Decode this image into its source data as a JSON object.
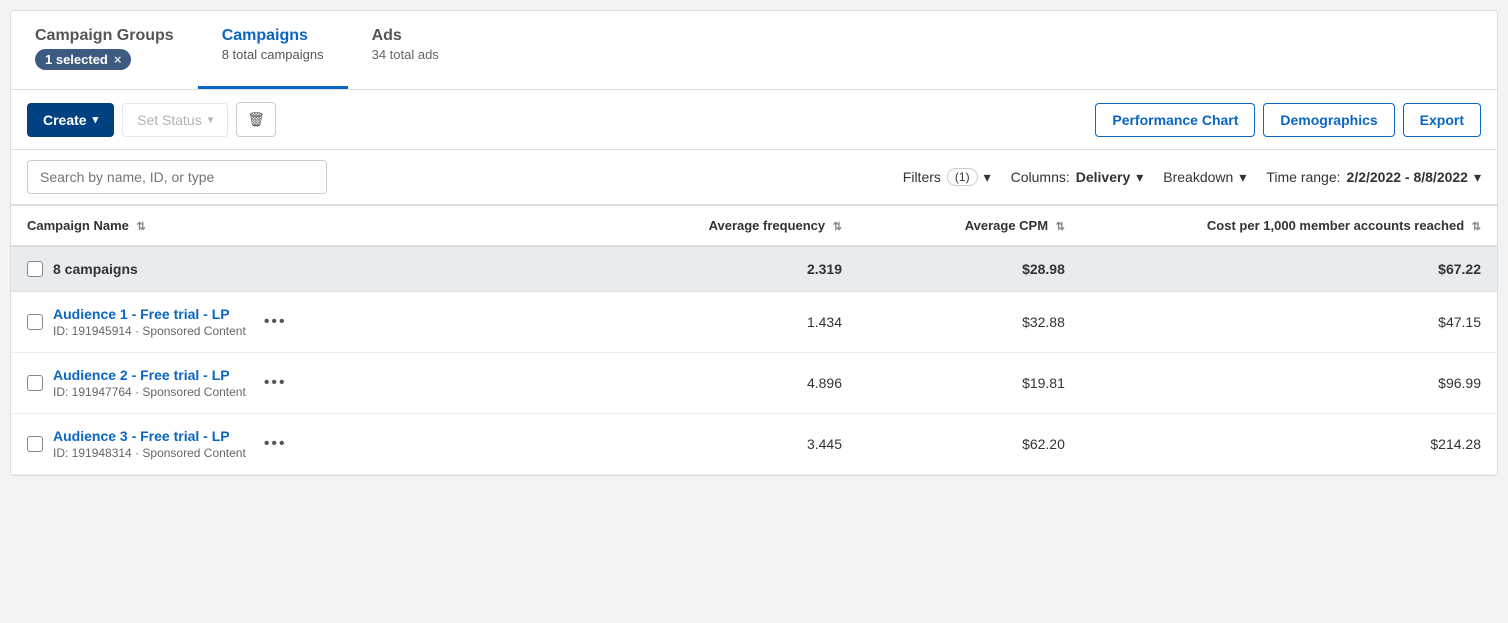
{
  "tabs": [
    {
      "id": "campaign-groups",
      "title": "Campaign Groups",
      "subtitle": "",
      "active": false
    },
    {
      "id": "campaigns",
      "title": "Campaigns",
      "subtitle": "8 total campaigns",
      "active": true
    },
    {
      "id": "ads",
      "title": "Ads",
      "subtitle": "34 total ads",
      "active": false
    }
  ],
  "selected_badge": "1 selected ×",
  "toolbar": {
    "create_label": "Create",
    "set_status_label": "Set Status",
    "delete_title": "Delete",
    "performance_chart_label": "Performance Chart",
    "demographics_label": "Demographics",
    "export_label": "Export"
  },
  "filters": {
    "search_placeholder": "Search by name, ID, or type",
    "filters_label": "Filters",
    "filters_count": "(1)",
    "columns_label": "Columns:",
    "columns_value": "Delivery",
    "breakdown_label": "Breakdown",
    "time_range_label": "Time range:",
    "time_range_value": "2/2/2022 - 8/8/2022"
  },
  "table": {
    "columns": [
      {
        "id": "name",
        "label": "Campaign Name"
      },
      {
        "id": "freq",
        "label": "Average frequency"
      },
      {
        "id": "cpm",
        "label": "Average CPM"
      },
      {
        "id": "cost",
        "label": "Cost per 1,000 member accounts reached"
      }
    ],
    "summary": {
      "label": "8 campaigns",
      "freq": "2.319",
      "cpm": "$28.98",
      "cost": "$67.22"
    },
    "rows": [
      {
        "name": "Audience 1 - Free trial - LP",
        "meta": "ID: 191945914 · Sponsored Content",
        "freq": "1.434",
        "cpm": "$32.88",
        "cost": "$47.15"
      },
      {
        "name": "Audience 2 - Free trial - LP",
        "meta": "ID: 191947764 · Sponsored Content",
        "freq": "4.896",
        "cpm": "$19.81",
        "cost": "$96.99"
      },
      {
        "name": "Audience 3 - Free trial - LP",
        "meta": "ID: 191948314 · Sponsored Content",
        "freq": "3.445",
        "cpm": "$62.20",
        "cost": "$214.28"
      }
    ]
  },
  "colors": {
    "primary": "#0a66c2",
    "dark_btn": "#004182",
    "badge_bg": "#3d5a80",
    "summary_bg": "#e8ecef"
  }
}
